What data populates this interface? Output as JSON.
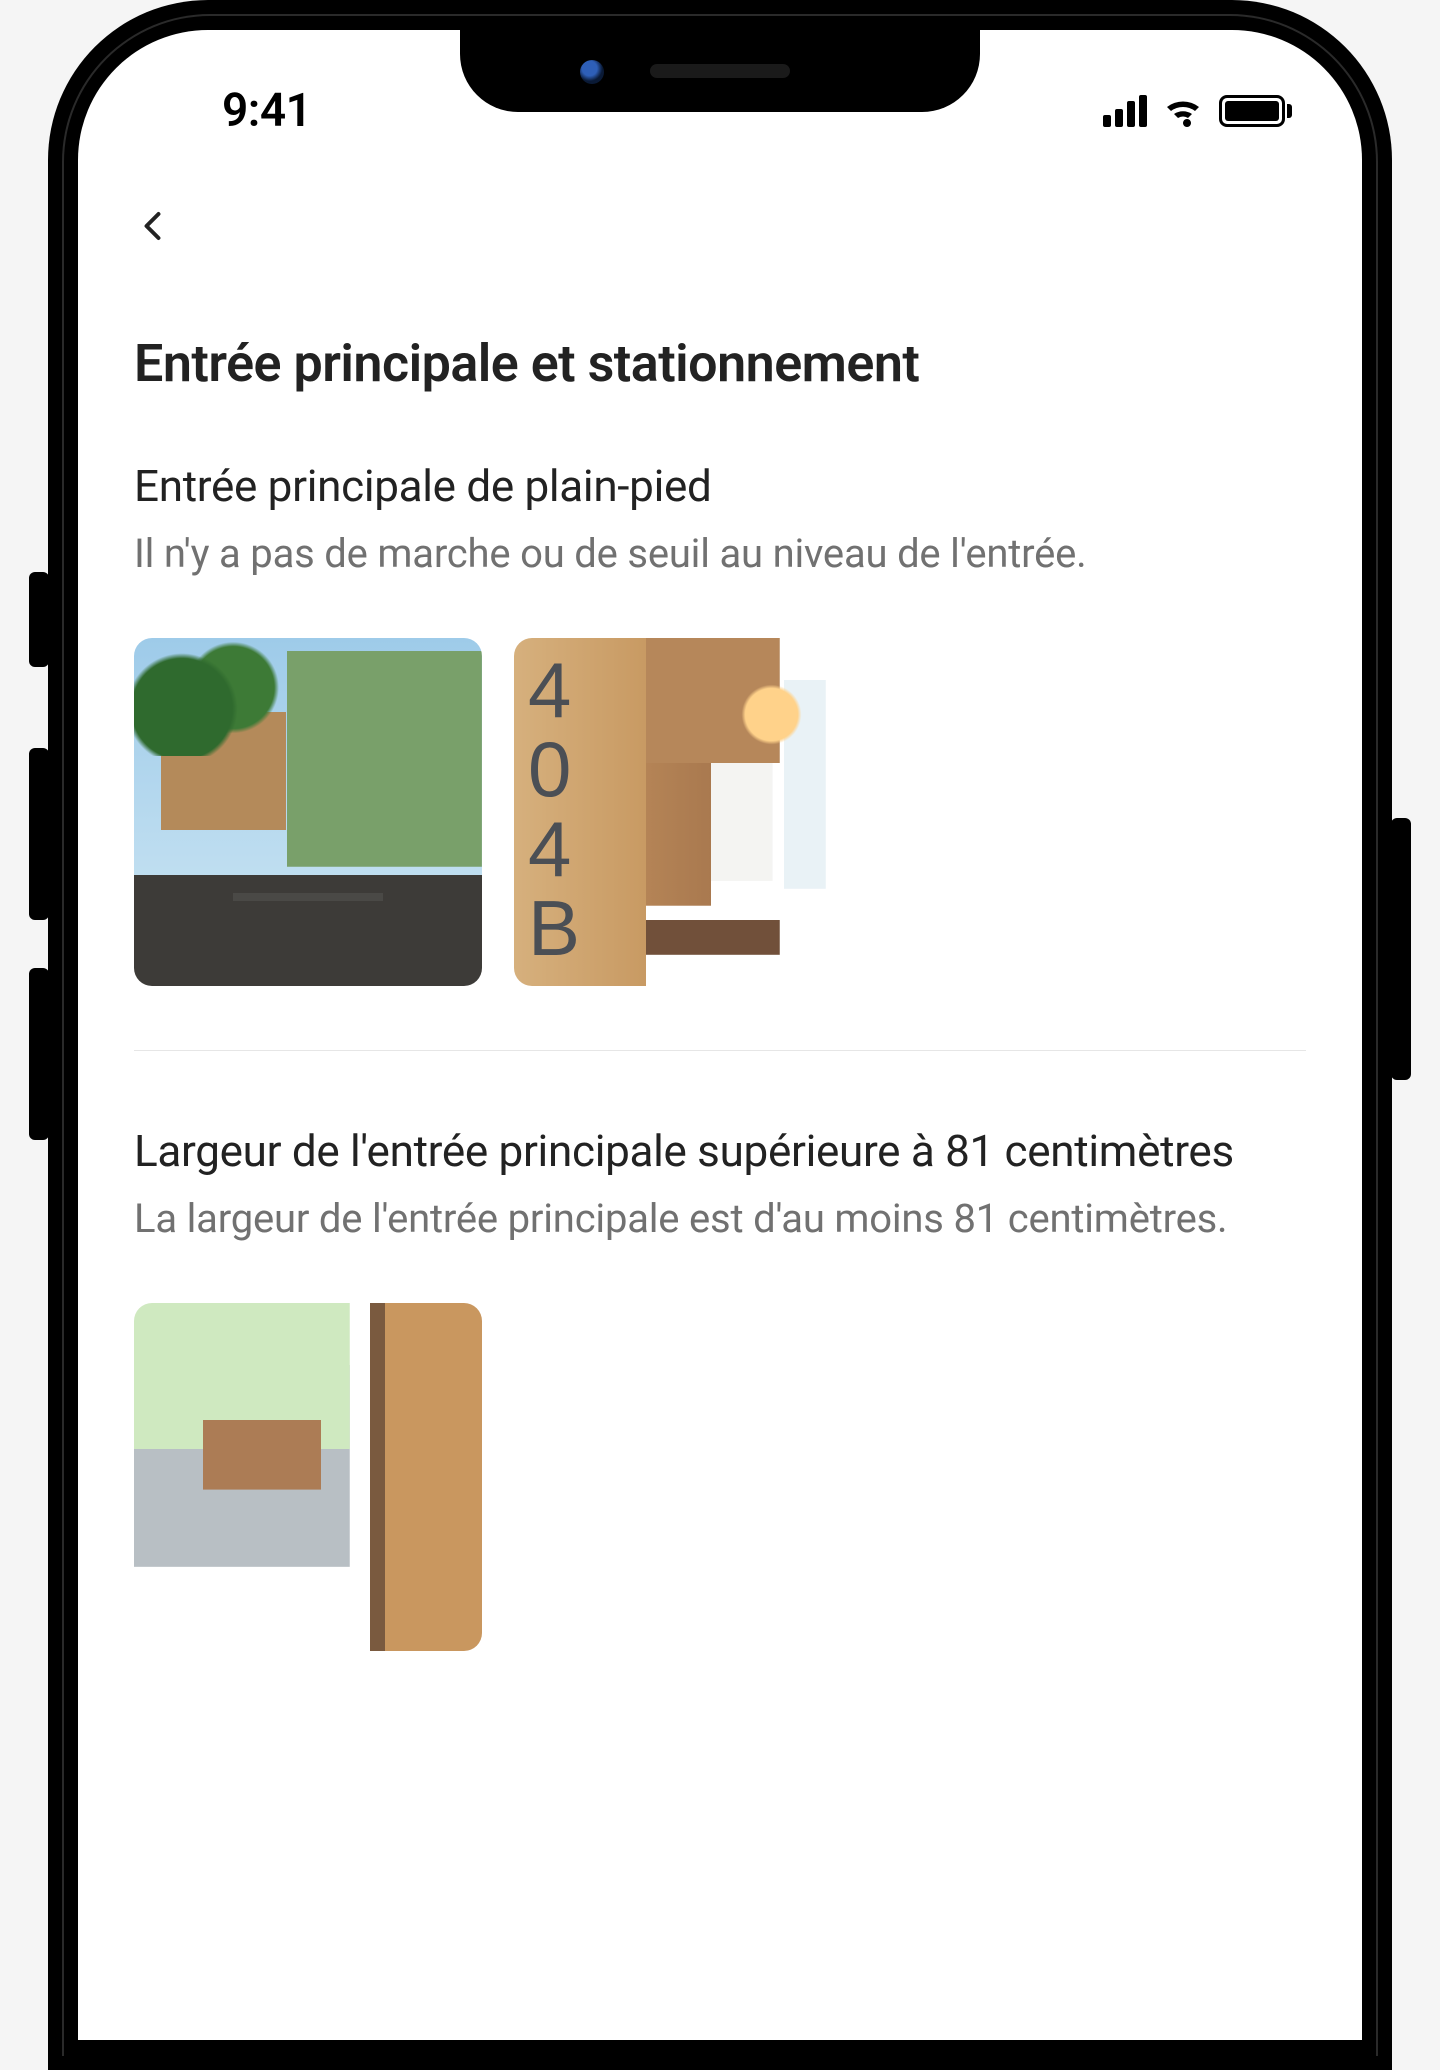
{
  "status_bar": {
    "time": "9:41",
    "signal_icon": "cellular-signal-icon",
    "wifi_icon": "wifi-icon",
    "battery_icon": "battery-full-icon"
  },
  "nav": {
    "back_icon": "chevron-left-icon"
  },
  "page": {
    "title": "Entrée principale et stationnement"
  },
  "features": [
    {
      "title": "Entrée principale de plain-pied",
      "description": "Il n'y a pas de marche ou de seuil au niveau de l'entrée.",
      "photos": [
        {
          "name": "photo-entrance-side-path",
          "alt": "Allée latérale menant à une porte d'une maison verte"
        },
        {
          "name": "photo-entrance-404b",
          "alt": "Entrée en bois avec le numéro 404B"
        }
      ],
      "address_number_digits": [
        "4",
        "0",
        "4",
        "B"
      ]
    },
    {
      "title": "Largeur de l'entrée principale supérieure à 81 centimètres",
      "description": "La largeur de l'entrée principale est d'au moins 81 centimètres.",
      "photos": [
        {
          "name": "photo-entrance-door-width",
          "alt": "Porte d'entrée ouverte montrant la largeur"
        }
      ]
    }
  ]
}
